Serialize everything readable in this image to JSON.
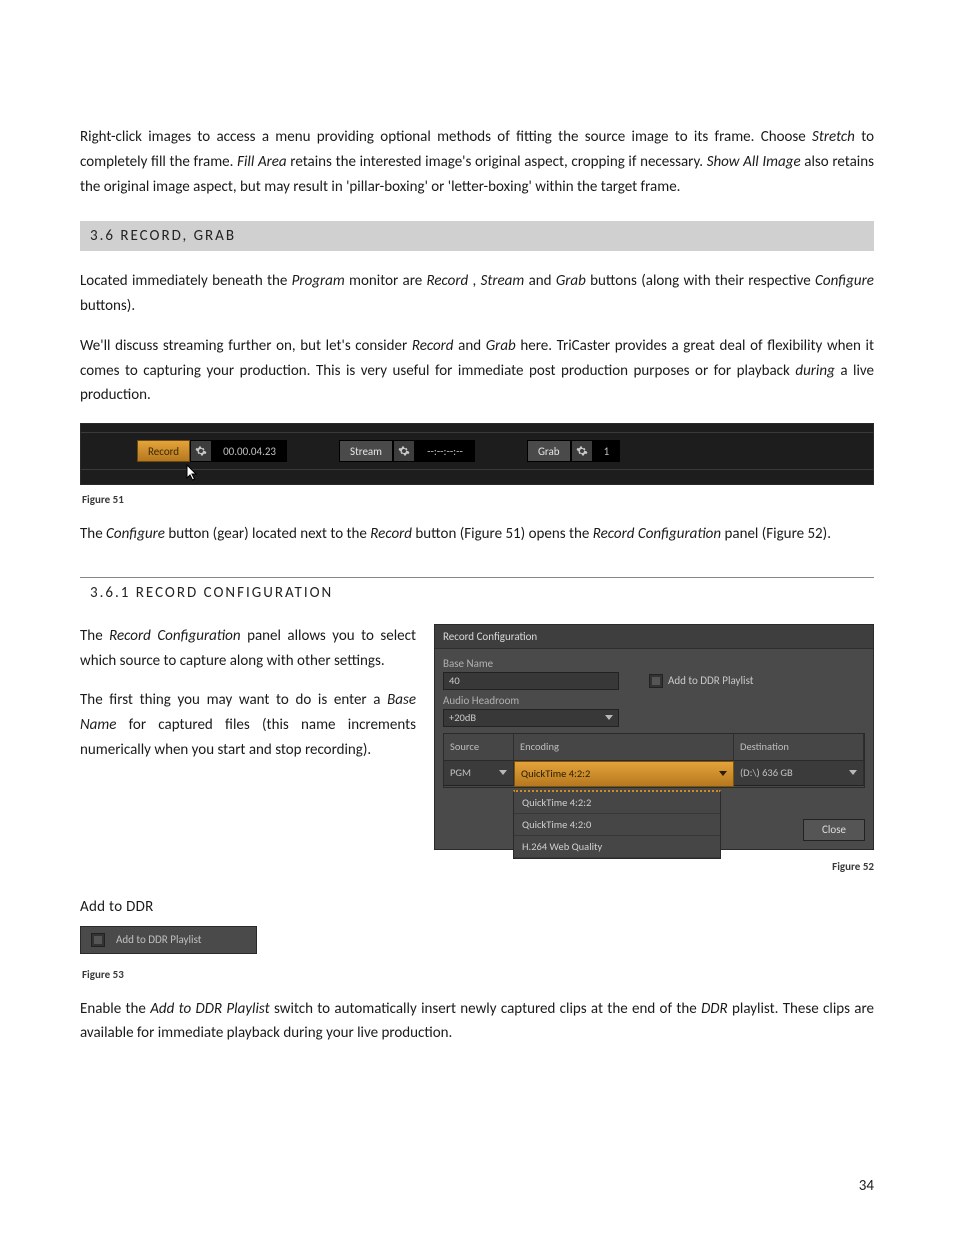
{
  "intro": {
    "p1a": "Right-click images to access a menu providing optional methods of fitting the source image to its frame.  Choose ",
    "w_stretch": "Stretch",
    "p1b": " to completely fill the frame.   ",
    "w_fill": "Fill Area",
    "p1c": " retains the interested image's original aspect, cropping if necessary.  ",
    "w_show": "Show All Image",
    "p1d": " also retains the original image aspect, but may result in 'pillar-boxing' or 'letter-boxing' within the target frame."
  },
  "heading36": "3.6   RECORD, GRAB",
  "p2": {
    "a": "Located immediately beneath the ",
    "w_program": "Program",
    "b": " monitor are ",
    "w_record": "Record",
    "c": ", ",
    "w_stream": "Stream",
    "d": " and ",
    "w_grab": "Grab",
    "e": " buttons (along with their respective ",
    "w_configure": "Configure",
    "f": " buttons)."
  },
  "p3": {
    "a": "We'll discuss streaming further on, but let's consider ",
    "w_record": "Record",
    "b": " and ",
    "w_grab": "Grab",
    "c": " here. TriCaster provides a great deal of flexibility when it comes to capturing your production.  This is very useful for immediate post production purposes or for playback ",
    "w_during": "during",
    "d": " a live production."
  },
  "fig51": {
    "record": "Record",
    "record_time": "00.00.04.23",
    "stream": "Stream",
    "stream_time": "--:--:--:--",
    "grab": "Grab",
    "grab_count": "1",
    "caption": "Figure 51"
  },
  "p4": {
    "a": "The ",
    "w_configure": "Configure",
    "b": " button (gear) located next to the ",
    "w_record": "Record",
    "c": " button (Figure 51) opens the ",
    "w_recconf": "Record Configuration",
    "d": " panel (Figure 52)."
  },
  "heading361": "3.6.1   RECORD CONFIGURATION",
  "p5": {
    "a": "The ",
    "w_recconf": "Record Configuration",
    "b": " panel allows you to select which source to capture along with other settings."
  },
  "p6": {
    "a": "The first thing you may want to do is enter a ",
    "w_base": "Base Name",
    "b": " for captured files (this name increments numerically when you start and stop recording)."
  },
  "fig52": {
    "title": "Record Configuration",
    "base_label": "Base Name",
    "base_value": "40",
    "add_ddr": "Add to DDR Playlist",
    "audio_label": "Audio Headroom",
    "audio_value": "+20dB",
    "col_source": "Source",
    "col_encoding": "Encoding",
    "col_dest": "Destination",
    "src_value": "PGM",
    "enc_value": "QuickTime 4:2:2",
    "dest_value": "(D:\\) 636 GB",
    "dd1": "QuickTime 4:2:2",
    "dd2": "QuickTime 4:2:0",
    "dd3": "H.264 Web Quality",
    "close": "Close",
    "caption": "Figure 52"
  },
  "add_ddr_h": "Add to DDR",
  "fig53": {
    "label": "Add to DDR Playlist",
    "caption": "Figure 53"
  },
  "p7": {
    "a": "Enable the ",
    "w_add": "Add to DDR Playlist",
    "b": " switch to automatically insert newly captured clips at the end of the ",
    "w_ddr": "DDR",
    "c": " playlist. These clips are available for immediate playback during your live production."
  },
  "page_number": "34"
}
